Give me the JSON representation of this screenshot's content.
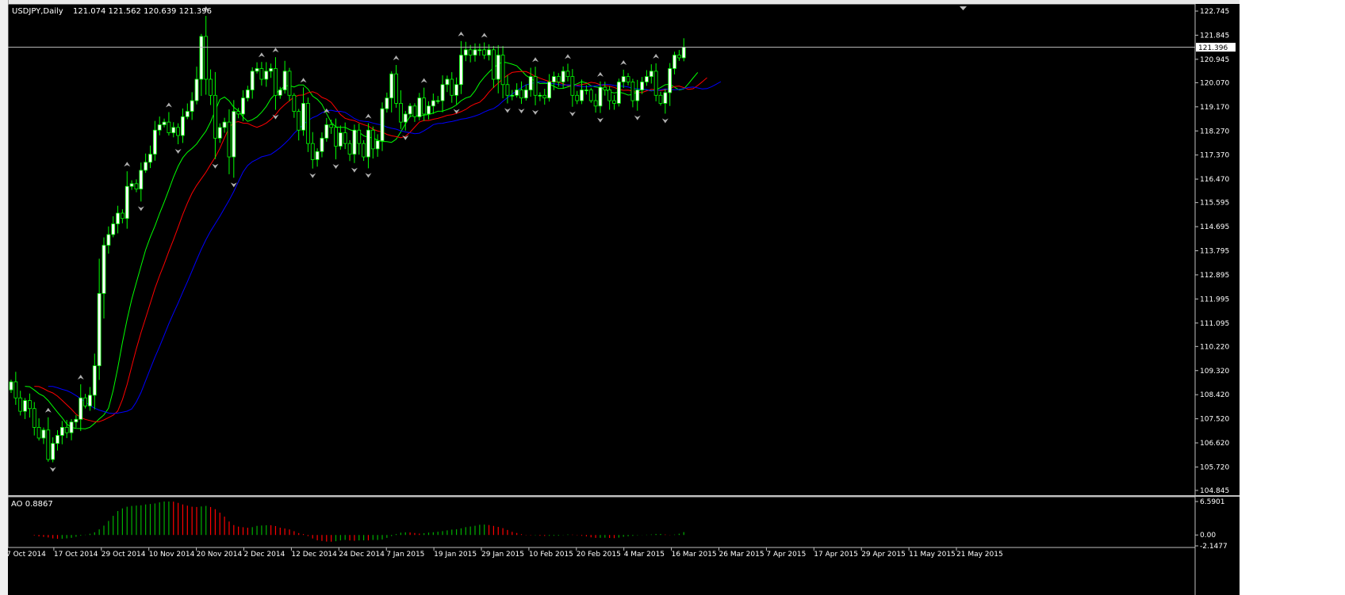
{
  "chart_header": {
    "symbol_timeframe": "USDJPY,Daily",
    "ohlc": "121.074 121.562 120.639 121.396"
  },
  "indicator_header": "AO 0.8867",
  "current_price_label": "121.396",
  "colors": {
    "background": "#000000",
    "bull_candle": "#ffffff",
    "bear_candle": "#000000",
    "candle_wick": "#00ff00",
    "alligator_lips": "#00ff00",
    "alligator_teeth": "#ff0000",
    "alligator_jaw": "#0000ff",
    "ao_up": "#00b000",
    "ao_down": "#ff0000",
    "fractal": "#b0b0b0",
    "axis_text": "#ffffff"
  },
  "chart_data": [
    {
      "type": "candlestick",
      "title": "USDJPY,Daily",
      "ylim": [
        104.845,
        122.745
      ],
      "y_ticks": [
        "122.745",
        "121.845",
        "120.945",
        "120.070",
        "119.170",
        "118.270",
        "117.370",
        "116.470",
        "115.595",
        "114.695",
        "113.795",
        "112.895",
        "111.995",
        "111.095",
        "110.220",
        "109.320",
        "108.420",
        "107.520",
        "106.620",
        "105.720",
        "104.845"
      ],
      "x_tick_labels": [
        "7 Oct 2014",
        "17 Oct 2014",
        "29 Oct 2014",
        "10 Nov 2014",
        "20 Nov 2014",
        "2 Dec 2014",
        "12 Dec 2014",
        "24 Dec 2014",
        "7 Jan 2015",
        "19 Jan 2015",
        "29 Jan 2015",
        "10 Feb 2015",
        "20 Feb 2015",
        "4 Mar 2015",
        "16 Mar 2015",
        "26 Mar 2015",
        "7 Apr 2015",
        "17 Apr 2015",
        "29 Apr 2015",
        "11 May 2015",
        "21 May 2015"
      ],
      "last_close": 121.396,
      "close": [
        108.9,
        108.3,
        107.8,
        108.2,
        107.9,
        107.2,
        106.8,
        107.1,
        106.0,
        106.6,
        106.9,
        107.2,
        107.0,
        107.4,
        107.5,
        108.3,
        108.0,
        108.4,
        109.5,
        112.2,
        114.0,
        114.4,
        114.8,
        115.2,
        115.0,
        116.2,
        116.3,
        116.1,
        116.8,
        117.1,
        117.4,
        118.3,
        118.5,
        118.6,
        118.2,
        118.4,
        118.1,
        118.8,
        119.0,
        119.4,
        120.2,
        121.8,
        120.2,
        119.6,
        118.0,
        118.4,
        118.6,
        117.3,
        119.0,
        118.9,
        119.5,
        119.8,
        120.5,
        120.6,
        120.2,
        120.5,
        120.6,
        119.6,
        119.8,
        120.5,
        119.6,
        119.0,
        118.3,
        119.3,
        117.8,
        117.2,
        117.5,
        118.0,
        118.5,
        118.4,
        117.7,
        118.2,
        117.8,
        117.4,
        118.3,
        117.8,
        117.3,
        118.3,
        117.6,
        117.9,
        119.1,
        119.5,
        120.4,
        119.3,
        118.6,
        118.9,
        119.2,
        118.8,
        119.5,
        118.9,
        119.2,
        119.4,
        119.4,
        120.0,
        120.2,
        119.6,
        120.0,
        121.1,
        121.3,
        121.1,
        121.3,
        121.3,
        121.1,
        121.3,
        120.2,
        121.1,
        120.0,
        119.6,
        119.6,
        119.8,
        119.5,
        119.8,
        120.3,
        119.6,
        119.6,
        119.5,
        120.1,
        120.3,
        120.1,
        120.5,
        120.3,
        119.6,
        119.4,
        119.8,
        119.8,
        119.4,
        119.2,
        119.9,
        119.8,
        119.4,
        119.3,
        120.1,
        120.3,
        120.1,
        119.4,
        119.8,
        120.1,
        120.3,
        120.5,
        119.6,
        119.3,
        119.7,
        120.6,
        121.1,
        121.0,
        121.396
      ],
      "series": [
        {
          "name": "Alligator Lips"
        },
        {
          "name": "Alligator Teeth"
        },
        {
          "name": "Alligator Jaw"
        }
      ]
    },
    {
      "type": "bar",
      "title": "AO 0.8867",
      "ylim": [
        -2.1477,
        6.5901
      ],
      "y_ticks": [
        "6.5901",
        "0.00",
        "-2.1477"
      ],
      "last_value": 0.8867
    }
  ]
}
